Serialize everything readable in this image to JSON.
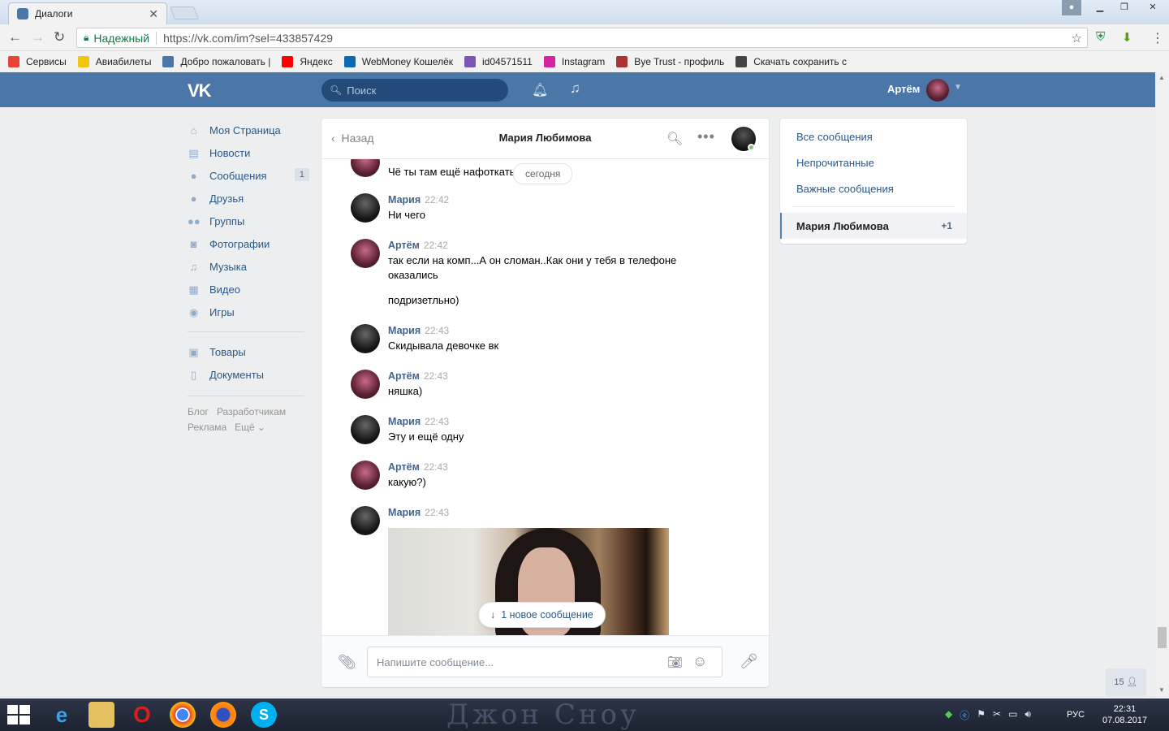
{
  "browser": {
    "tab_title": "Диалоги",
    "secure_label": "Надежный",
    "url": "https://vk.com/im?sel=433857429",
    "bookmarks": [
      {
        "label": "Сервисы",
        "icon": "apps-grid-icon",
        "color": "#e94335"
      },
      {
        "label": "Авиабилеты",
        "icon": "airplane-icon",
        "color": "#f1c40f"
      },
      {
        "label": "Добро пожаловать |",
        "icon": "vk-icon",
        "color": "#4a76a8"
      },
      {
        "label": "Яндекс",
        "icon": "yandex-icon",
        "color": "#ff0000"
      },
      {
        "label": "WebMoney Кошелёк",
        "icon": "webmoney-icon",
        "color": "#0b68b3"
      },
      {
        "label": "id04571511",
        "icon": "skype-s-icon",
        "color": "#7b57b3"
      },
      {
        "label": "Instagram",
        "icon": "instagram-icon",
        "color": "#d6249f"
      },
      {
        "label": "Bye Trust - профиль",
        "icon": "byetrust-icon",
        "color": "#a33"
      },
      {
        "label": "Скачать сохранить с",
        "icon": "savefrom-icon",
        "color": "#444"
      }
    ]
  },
  "vk": {
    "search_placeholder": "Поиск",
    "user_name": "Артём",
    "menu": [
      {
        "label": "Моя Страница",
        "icon": "home-icon",
        "glyph": "⌂"
      },
      {
        "label": "Новости",
        "icon": "news-icon",
        "glyph": "▤"
      },
      {
        "label": "Сообщения",
        "icon": "messages-icon",
        "glyph": "●",
        "badge": "1"
      },
      {
        "label": "Друзья",
        "icon": "friends-icon",
        "glyph": "●"
      },
      {
        "label": "Группы",
        "icon": "groups-icon",
        "glyph": "●●"
      },
      {
        "label": "Фотографии",
        "icon": "photos-icon",
        "glyph": "◙"
      },
      {
        "label": "Музыка",
        "icon": "music-icon",
        "glyph": "♫"
      },
      {
        "label": "Видео",
        "icon": "video-icon",
        "glyph": "▦"
      },
      {
        "label": "Игры",
        "icon": "games-icon",
        "glyph": "◉"
      }
    ],
    "menu2": [
      {
        "label": "Товары",
        "icon": "goods-icon",
        "glyph": "▣"
      },
      {
        "label": "Документы",
        "icon": "documents-icon",
        "glyph": "▯"
      }
    ],
    "footer": [
      "Блог",
      "Разработчикам",
      "Реклама",
      "Ещё ⌄"
    ]
  },
  "chat": {
    "back_label": "Назад",
    "title": "Мария Любимова",
    "date_pill": "сегодня",
    "first_text": "Чё ты там ещё нафоткать",
    "messages": [
      {
        "author": "Мария",
        "time": "22:42",
        "text": "Ни чего",
        "avatar": "maria"
      },
      {
        "author": "Артём",
        "time": "22:42",
        "text": "так если на комп...А он сломан..Как они у тебя в телефоне оказались",
        "text2": "подризетльно)",
        "avatar": "artem"
      },
      {
        "author": "Мария",
        "time": "22:43",
        "text": "Скидывала девочке вк",
        "avatar": "maria"
      },
      {
        "author": "Артём",
        "time": "22:43",
        "text": "няшка)",
        "avatar": "artem"
      },
      {
        "author": "Мария",
        "time": "22:43",
        "text": "Эту и ещё одну",
        "avatar": "maria"
      },
      {
        "author": "Артём",
        "time": "22:43",
        "text": "какую?)",
        "avatar": "artem"
      },
      {
        "author": "Мария",
        "time": "22:43",
        "text": "",
        "avatar": "maria",
        "photo": true
      }
    ],
    "new_message_pill": "1 новое сообщение",
    "input_placeholder": "Напишите сообщение..."
  },
  "filters": {
    "all": "Все сообщения",
    "unread": "Непрочитанные",
    "important": "Важные сообщения",
    "active_dialog": "Мария Любимова",
    "active_count": "+1"
  },
  "online_friends_count": "15",
  "taskbar": {
    "watermark": "Джон Сноу",
    "language": "РУС",
    "time": "22:31",
    "date": "07.08.2017"
  }
}
